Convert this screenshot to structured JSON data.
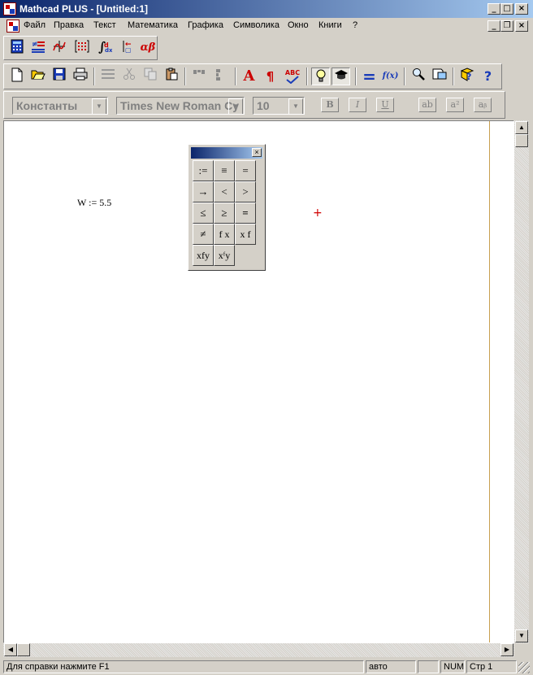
{
  "window": {
    "title": "Mathcad PLUS - [Untitled:1]",
    "caption_buttons": [
      "_",
      "□",
      "×"
    ],
    "doc_buttons": [
      "_",
      "❐",
      "×"
    ]
  },
  "menu": [
    {
      "label": "Файл",
      "name": "menu-file"
    },
    {
      "label": "Правка",
      "name": "menu-edit"
    },
    {
      "label": "Текст",
      "name": "menu-text"
    },
    {
      "label": "Математика",
      "name": "menu-math"
    },
    {
      "label": "Графика",
      "name": "menu-graphics"
    },
    {
      "label": "Символика",
      "name": "menu-symbolics"
    },
    {
      "label": "Окно",
      "name": "menu-window"
    },
    {
      "label": "Книги",
      "name": "menu-books"
    },
    {
      "label": "?",
      "name": "menu-help"
    }
  ],
  "math_palette_toolbar": [
    "calculator-icon",
    "evaluation-icon",
    "graph-icon",
    "matrix-icon",
    "calculus-icon",
    "programming-icon",
    "greek-icon"
  ],
  "greek_label": "αβ",
  "standard_toolbar": {
    "icons": [
      "new-icon",
      "open-icon",
      "save-icon",
      "print-icon",
      "check-spelling-icon",
      "cut-icon",
      "copy-icon",
      "paste-icon",
      "align-across-icon",
      "align-down-icon",
      "text-region-icon",
      "paragraph-icon",
      "spellcheck-icon",
      "lightbulb-icon",
      "graduation-cap-icon",
      "calculate-icon",
      "function-icon",
      "zoom-icon",
      "resources-icon",
      "help-book-icon",
      "help-icon"
    ],
    "text_region_glyph": "A",
    "paragraph_glyph": "¶",
    "spell_glyph": "ABC",
    "calculate_glyph": "=",
    "function_glyph": "f(x)",
    "help_glyph": "?"
  },
  "format_bar": {
    "style_value": "Константы",
    "font_value": "Times New Roman Cy",
    "size_value": "10",
    "bold_label": "B",
    "italic_label": "I",
    "underline_label": "U",
    "subscript_label": "ab",
    "superscript_label": "a²",
    "subscript2_label": "aᵦ"
  },
  "worksheet": {
    "region_text": "W := 5.5",
    "cursor_glyph": "+"
  },
  "evaluation_palette": {
    "buttons": [
      {
        "label": ":=",
        "name": "definition-button"
      },
      {
        "label": "≡",
        "name": "global-definition-button"
      },
      {
        "label": "=",
        "name": "evaluate-button"
      },
      {
        "label": "→",
        "name": "symbolic-evaluate-button"
      },
      {
        "label": "<",
        "name": "less-than-button"
      },
      {
        "label": ">",
        "name": "greater-than-button"
      },
      {
        "label": "≤",
        "name": "less-equal-button"
      },
      {
        "label": "≥",
        "name": "greater-equal-button"
      },
      {
        "label": "=",
        "name": "boolean-equal-button"
      },
      {
        "label": "≠",
        "name": "not-equal-button"
      },
      {
        "label": "f x",
        "name": "prefix-operator-button"
      },
      {
        "label": "x f",
        "name": "postfix-operator-button"
      },
      {
        "label": "xfy",
        "name": "infix-operator-button"
      },
      {
        "label": "xᶠy",
        "name": "treefix-operator-button"
      }
    ],
    "close_glyph": "×"
  },
  "status_bar": {
    "help_text": "Для справки нажмите F1",
    "mode": "авто",
    "num": "NUM",
    "page": "Стр 1"
  }
}
